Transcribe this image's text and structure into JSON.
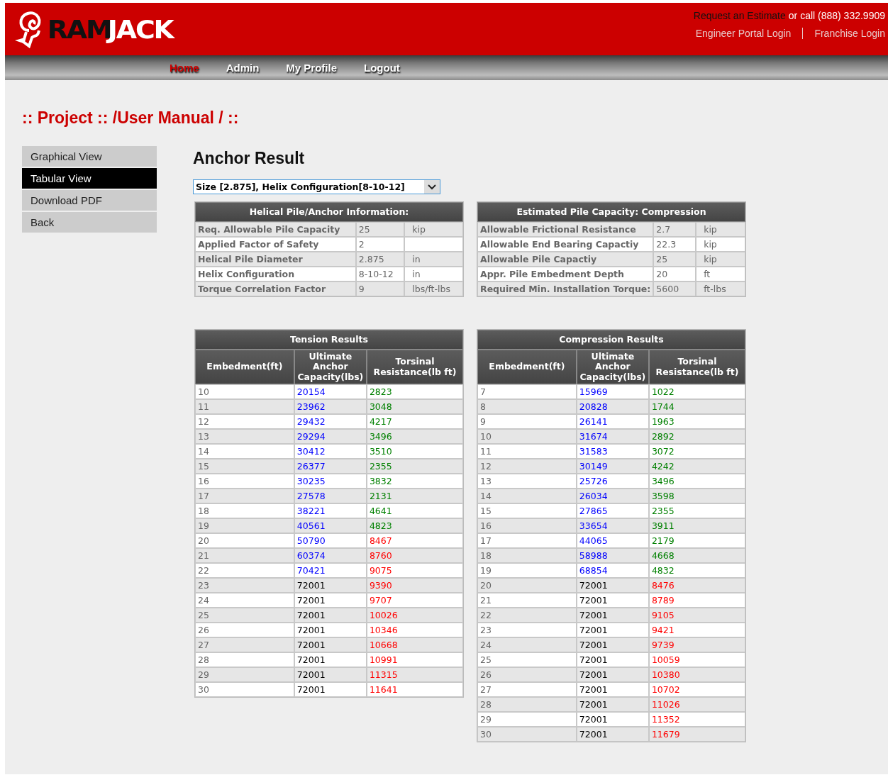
{
  "header": {
    "logo": {
      "part_1": "RAM",
      "part_2": "JACK"
    },
    "estimate_link": "Request an Estimate",
    "call_text": "or call (888) 332.9909",
    "links": [
      "Engineer Portal Login",
      "Franchise Login"
    ]
  },
  "nav": [
    {
      "label": "Home",
      "selected": true
    },
    {
      "label": "Admin",
      "selected": false
    },
    {
      "label": "My Profile",
      "selected": false
    },
    {
      "label": "Logout",
      "selected": false
    }
  ],
  "breadcrumb": ":: Project :: /User Manual / ::",
  "sidebar": [
    {
      "label": "Graphical View",
      "selected": false
    },
    {
      "label": "Tabular View",
      "selected": true
    },
    {
      "label": "Download PDF",
      "selected": false
    },
    {
      "label": "Back",
      "selected": false
    }
  ],
  "title": "Anchor Result",
  "size_select": {
    "value": "Size [2.875], Helix Configuration[8-10-12]"
  },
  "info_tables": [
    {
      "title": "Helical Pile/Anchor Information:",
      "rows": [
        [
          "Req. Allowable Pile Capacity",
          "25",
          "kip"
        ],
        [
          "Applied Factor of Safety",
          "2",
          ""
        ],
        [
          "Helical Pile Diameter",
          "2.875",
          "in"
        ],
        [
          "Helix Configuration",
          "8-10-12",
          "in"
        ],
        [
          "Torque Correlation Factor",
          "9",
          "lbs/ft-lbs"
        ]
      ]
    },
    {
      "title": "Estimated Pile Capacity: Compression",
      "rows": [
        [
          "Allowable Frictional Resistance",
          "2.7",
          "kip"
        ],
        [
          "Allowable End Bearing Capactiy",
          "22.3",
          "kip"
        ],
        [
          "Allowable Pile Capactiy",
          "25",
          "kip"
        ],
        [
          "Appr. Pile Embedment Depth",
          "20",
          "ft"
        ],
        [
          "Required Min. Installation Torque:",
          "5600",
          "ft-lbs"
        ]
      ]
    }
  ],
  "result_tables": [
    {
      "title": "Tension Results",
      "columns": [
        "Embedment(ft)",
        "Ultimate Anchor Capacity(lbs)",
        "Torsinal Resistance(lb ft)"
      ],
      "rows": [
        {
          "embedment": "10",
          "capacity": {
            "text": "20154",
            "color": "#0000ff"
          },
          "torsional": {
            "text": "2823",
            "color": "#008000"
          }
        },
        {
          "embedment": "11",
          "capacity": {
            "text": "23962",
            "color": "#0000ff"
          },
          "torsional": {
            "text": "3048",
            "color": "#008000"
          }
        },
        {
          "embedment": "12",
          "capacity": {
            "text": "29432",
            "color": "#0000ff"
          },
          "torsional": {
            "text": "4217",
            "color": "#008000"
          }
        },
        {
          "embedment": "13",
          "capacity": {
            "text": "29294",
            "color": "#0000ff"
          },
          "torsional": {
            "text": "3496",
            "color": "#008000"
          }
        },
        {
          "embedment": "14",
          "capacity": {
            "text": "30412",
            "color": "#0000ff"
          },
          "torsional": {
            "text": "3510",
            "color": "#008000"
          }
        },
        {
          "embedment": "15",
          "capacity": {
            "text": "26377",
            "color": "#0000ff"
          },
          "torsional": {
            "text": "2355",
            "color": "#008000"
          }
        },
        {
          "embedment": "16",
          "capacity": {
            "text": "30235",
            "color": "#0000ff"
          },
          "torsional": {
            "text": "3832",
            "color": "#008000"
          }
        },
        {
          "embedment": "17",
          "capacity": {
            "text": "27578",
            "color": "#0000ff"
          },
          "torsional": {
            "text": "2131",
            "color": "#008000"
          }
        },
        {
          "embedment": "18",
          "capacity": {
            "text": "38221",
            "color": "#0000ff"
          },
          "torsional": {
            "text": "4641",
            "color": "#008000"
          }
        },
        {
          "embedment": "19",
          "capacity": {
            "text": "40561",
            "color": "#0000ff"
          },
          "torsional": {
            "text": "4823",
            "color": "#008000"
          }
        },
        {
          "embedment": "20",
          "capacity": {
            "text": "50790",
            "color": "#0000ff"
          },
          "torsional": {
            "text": "8467",
            "color": "#ff0000"
          }
        },
        {
          "embedment": "21",
          "capacity": {
            "text": "60374",
            "color": "#0000ff"
          },
          "torsional": {
            "text": "8760",
            "color": "#ff0000"
          }
        },
        {
          "embedment": "22",
          "capacity": {
            "text": "70421",
            "color": "#0000ff"
          },
          "torsional": {
            "text": "9075",
            "color": "#ff0000"
          }
        },
        {
          "embedment": "23",
          "capacity": {
            "text": "72001",
            "color": "#000000"
          },
          "torsional": {
            "text": "9390",
            "color": "#ff0000"
          }
        },
        {
          "embedment": "24",
          "capacity": {
            "text": "72001",
            "color": "#000000"
          },
          "torsional": {
            "text": "9707",
            "color": "#ff0000"
          }
        },
        {
          "embedment": "25",
          "capacity": {
            "text": "72001",
            "color": "#000000"
          },
          "torsional": {
            "text": "10026",
            "color": "#ff0000"
          }
        },
        {
          "embedment": "26",
          "capacity": {
            "text": "72001",
            "color": "#000000"
          },
          "torsional": {
            "text": "10346",
            "color": "#ff0000"
          }
        },
        {
          "embedment": "27",
          "capacity": {
            "text": "72001",
            "color": "#000000"
          },
          "torsional": {
            "text": "10668",
            "color": "#ff0000"
          }
        },
        {
          "embedment": "28",
          "capacity": {
            "text": "72001",
            "color": "#000000"
          },
          "torsional": {
            "text": "10991",
            "color": "#ff0000"
          }
        },
        {
          "embedment": "29",
          "capacity": {
            "text": "72001",
            "color": "#000000"
          },
          "torsional": {
            "text": "11315",
            "color": "#ff0000"
          }
        },
        {
          "embedment": "30",
          "capacity": {
            "text": "72001",
            "color": "#000000"
          },
          "torsional": {
            "text": "11641",
            "color": "#ff0000"
          }
        }
      ]
    },
    {
      "title": "Compression Results",
      "columns": [
        "Embedment(ft)",
        "Ultimate Anchor Capacity(lbs)",
        "Torsinal Resistance(lb ft)"
      ],
      "rows": [
        {
          "embedment": "7",
          "capacity": {
            "text": "15969",
            "color": "#0000ff"
          },
          "torsional": {
            "text": "1022",
            "color": "#008000"
          }
        },
        {
          "embedment": "8",
          "capacity": {
            "text": "20828",
            "color": "#0000ff"
          },
          "torsional": {
            "text": "1744",
            "color": "#008000"
          }
        },
        {
          "embedment": "9",
          "capacity": {
            "text": "26141",
            "color": "#0000ff"
          },
          "torsional": {
            "text": "1963",
            "color": "#008000"
          }
        },
        {
          "embedment": "10",
          "capacity": {
            "text": "31674",
            "color": "#0000ff"
          },
          "torsional": {
            "text": "2892",
            "color": "#008000"
          }
        },
        {
          "embedment": "11",
          "capacity": {
            "text": "31583",
            "color": "#0000ff"
          },
          "torsional": {
            "text": "3072",
            "color": "#008000"
          }
        },
        {
          "embedment": "12",
          "capacity": {
            "text": "30149",
            "color": "#0000ff"
          },
          "torsional": {
            "text": "4242",
            "color": "#008000"
          }
        },
        {
          "embedment": "13",
          "capacity": {
            "text": "25726",
            "color": "#0000ff"
          },
          "torsional": {
            "text": "3496",
            "color": "#008000"
          }
        },
        {
          "embedment": "14",
          "capacity": {
            "text": "26034",
            "color": "#0000ff"
          },
          "torsional": {
            "text": "3598",
            "color": "#008000"
          }
        },
        {
          "embedment": "15",
          "capacity": {
            "text": "27865",
            "color": "#0000ff"
          },
          "torsional": {
            "text": "2355",
            "color": "#008000"
          }
        },
        {
          "embedment": "16",
          "capacity": {
            "text": "33654",
            "color": "#0000ff"
          },
          "torsional": {
            "text": "3911",
            "color": "#008000"
          }
        },
        {
          "embedment": "17",
          "capacity": {
            "text": "44065",
            "color": "#0000ff"
          },
          "torsional": {
            "text": "2179",
            "color": "#008000"
          }
        },
        {
          "embedment": "18",
          "capacity": {
            "text": "58988",
            "color": "#0000ff"
          },
          "torsional": {
            "text": "4668",
            "color": "#008000"
          }
        },
        {
          "embedment": "19",
          "capacity": {
            "text": "68854",
            "color": "#0000ff"
          },
          "torsional": {
            "text": "4832",
            "color": "#008000"
          }
        },
        {
          "embedment": "20",
          "capacity": {
            "text": "72001",
            "color": "#000000"
          },
          "torsional": {
            "text": "8476",
            "color": "#ff0000"
          }
        },
        {
          "embedment": "21",
          "capacity": {
            "text": "72001",
            "color": "#000000"
          },
          "torsional": {
            "text": "8789",
            "color": "#ff0000"
          }
        },
        {
          "embedment": "22",
          "capacity": {
            "text": "72001",
            "color": "#000000"
          },
          "torsional": {
            "text": "9105",
            "color": "#ff0000"
          }
        },
        {
          "embedment": "23",
          "capacity": {
            "text": "72001",
            "color": "#000000"
          },
          "torsional": {
            "text": "9421",
            "color": "#ff0000"
          }
        },
        {
          "embedment": "24",
          "capacity": {
            "text": "72001",
            "color": "#000000"
          },
          "torsional": {
            "text": "9739",
            "color": "#ff0000"
          }
        },
        {
          "embedment": "25",
          "capacity": {
            "text": "72001",
            "color": "#000000"
          },
          "torsional": {
            "text": "10059",
            "color": "#ff0000"
          }
        },
        {
          "embedment": "26",
          "capacity": {
            "text": "72001",
            "color": "#000000"
          },
          "torsional": {
            "text": "10380",
            "color": "#ff0000"
          }
        },
        {
          "embedment": "27",
          "capacity": {
            "text": "72001",
            "color": "#000000"
          },
          "torsional": {
            "text": "10702",
            "color": "#ff0000"
          }
        },
        {
          "embedment": "28",
          "capacity": {
            "text": "72001",
            "color": "#000000"
          },
          "torsional": {
            "text": "11026",
            "color": "#ff0000"
          }
        },
        {
          "embedment": "29",
          "capacity": {
            "text": "72001",
            "color": "#000000"
          },
          "torsional": {
            "text": "11352",
            "color": "#ff0000"
          }
        },
        {
          "embedment": "30",
          "capacity": {
            "text": "72001",
            "color": "#000000"
          },
          "torsional": {
            "text": "11679",
            "color": "#ff0000"
          }
        }
      ]
    }
  ]
}
